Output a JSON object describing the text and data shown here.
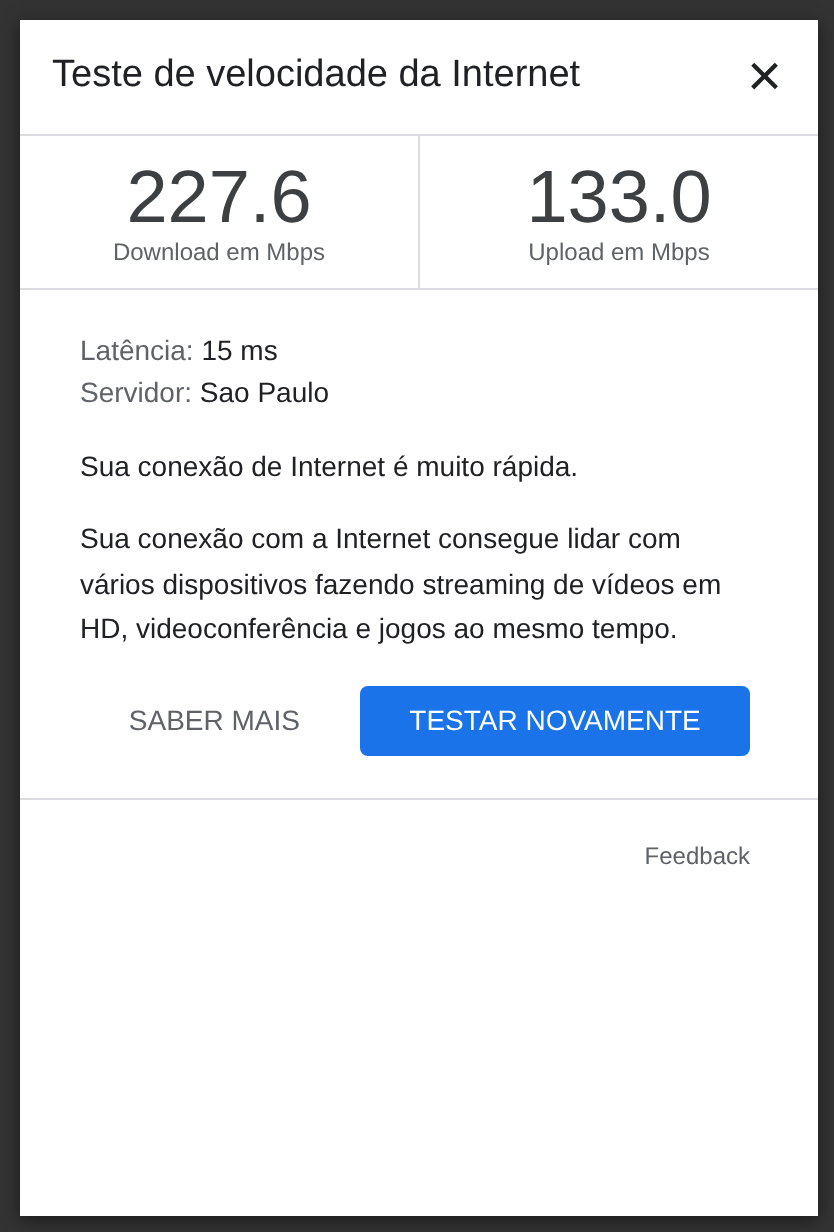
{
  "dialog": {
    "title": "Teste de velocidade da Internet",
    "close": "×"
  },
  "results": [
    {
      "value": "227.6",
      "label": "Download em Mbps"
    },
    {
      "value": "133.0",
      "label": "Upload em Mbps"
    }
  ],
  "details": [
    {
      "label": "Latência:",
      "value": "15 ms"
    },
    {
      "label": "Servidor:",
      "value": "Sao Paulo"
    }
  ],
  "summary": "Sua conexão de Internet é muito rápida.",
  "description": "Sua conexão com a Internet consegue lidar com vários dispositivos fazendo streaming de vídeos em HD, videoconferência e jogos ao mesmo tempo.",
  "buttons": [
    {
      "label": "SABER MAIS",
      "kind": "text"
    },
    {
      "label": "TESTAR NOVAMENTE",
      "kind": "primary"
    }
  ],
  "feedback": "Feedback"
}
